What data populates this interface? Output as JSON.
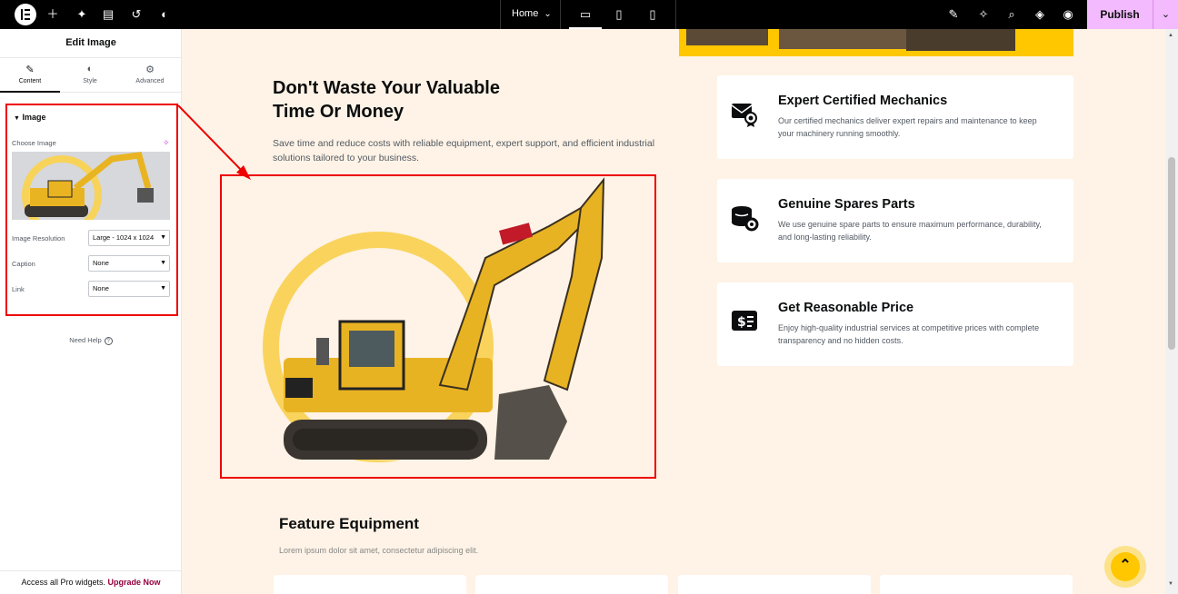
{
  "topbar": {
    "page_label": "Home",
    "publish_label": "Publish",
    "icons": [
      "elementor-logo-icon",
      "add-element-icon",
      "site-settings-icon",
      "structure-icon",
      "history-icon",
      "theme-icon"
    ],
    "right_icons": [
      "ai-icon",
      "notifications-icon",
      "search-icon",
      "layers-icon",
      "preview-icon"
    ]
  },
  "panel": {
    "title": "Edit Image",
    "tabs": [
      {
        "label": "Content"
      },
      {
        "label": "Style"
      },
      {
        "label": "Advanced"
      }
    ],
    "section_title": "Image",
    "choose_image_label": "Choose Image",
    "resolution_label": "Image Resolution",
    "resolution_value": "Large - 1024 x 1024",
    "caption_label": "Caption",
    "caption_value": "None",
    "link_label": "Link",
    "link_value": "None",
    "need_help": "Need Help",
    "promo_text": "Access all Pro widgets.",
    "promo_link": "Upgrade Now"
  },
  "content": {
    "headline_line1": "Don't Waste Your Valuable",
    "headline_line2": "Time Or Money",
    "subtext": "Save time and reduce costs with reliable equipment, expert support, and efficient industrial solutions tailored to your business.",
    "cards": [
      {
        "title": "Expert Certified Mechanics",
        "desc": "Our certified mechanics deliver expert repairs and maintenance to keep your machinery running smoothly.",
        "icon": "certificate-icon"
      },
      {
        "title": "Genuine Spares Parts",
        "desc": "We use genuine spare parts to ensure maximum performance, durability, and long-lasting reliability.",
        "icon": "spare-parts-icon"
      },
      {
        "title": "Get Reasonable Price",
        "desc": "Enjoy high-quality industrial services at competitive prices with complete transparency and no hidden costs.",
        "icon": "price-icon"
      }
    ],
    "feature_title": "Feature Equipment",
    "feature_sub": "Lorem ipsum dolor sit amet, consectetur adipiscing elit."
  },
  "colors": {
    "accent_yellow": "#ffc700",
    "canvas_bg": "#fef3e6",
    "publish_bg": "#f3bafd",
    "highlight_red": "#e00000"
  }
}
